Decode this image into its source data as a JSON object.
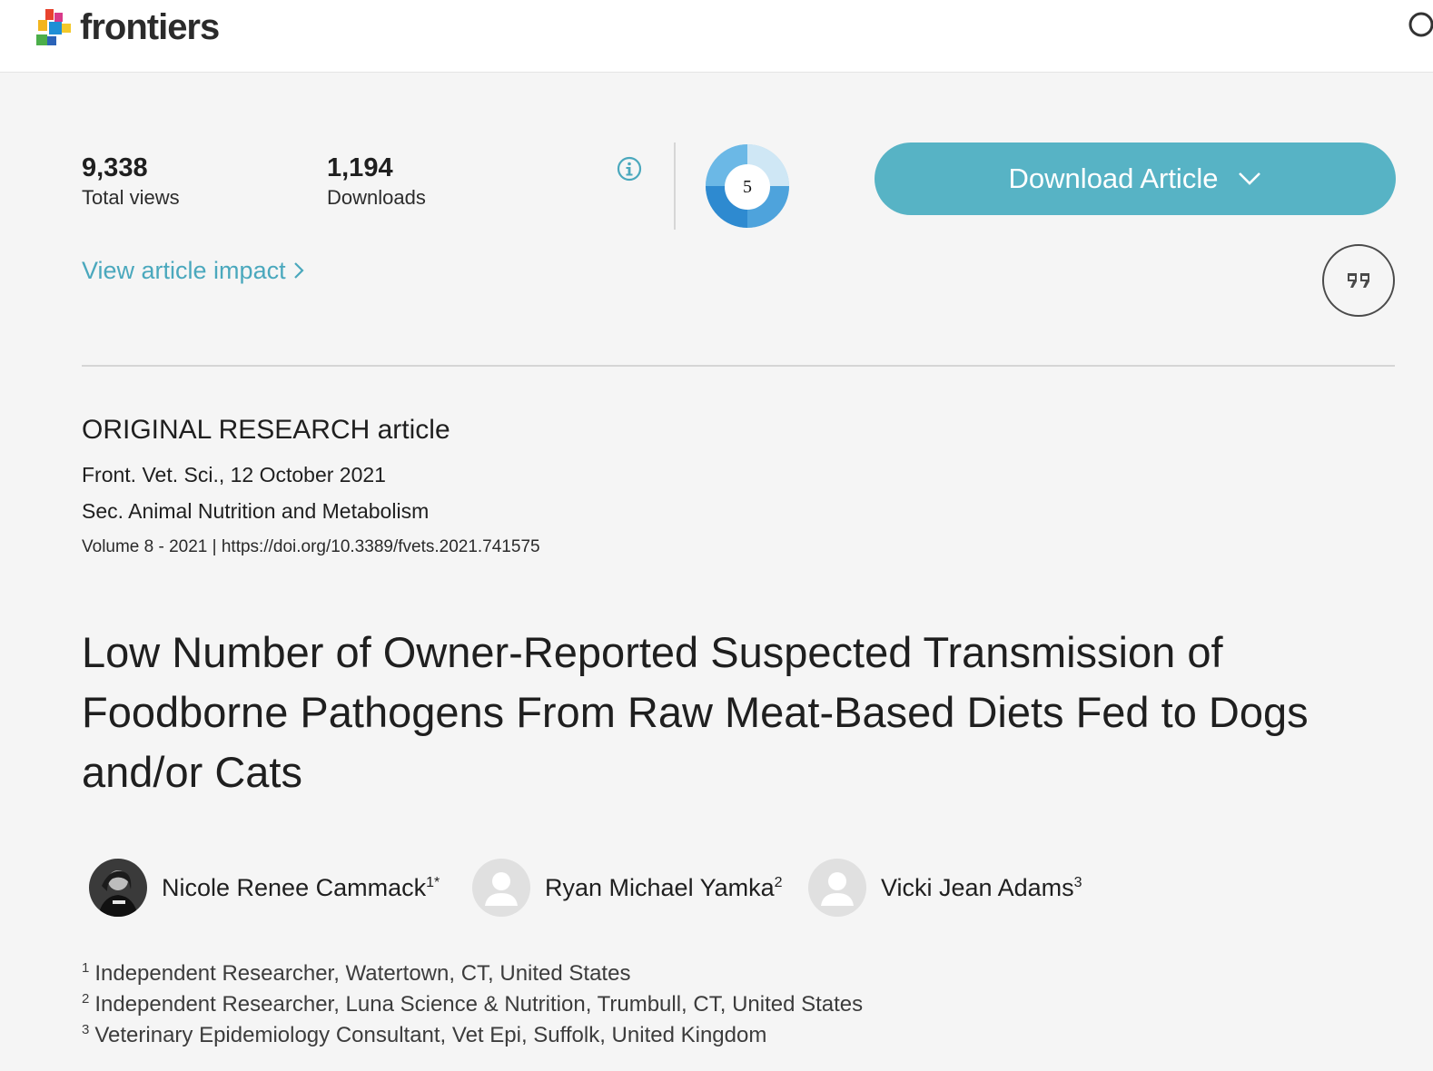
{
  "header": {
    "brand": "frontiers"
  },
  "metrics": {
    "total_views_value": "9,338",
    "total_views_label": "Total views",
    "downloads_value": "1,194",
    "downloads_label": "Downloads",
    "altmetric_score": "5",
    "view_impact_label": "View article impact"
  },
  "actions": {
    "download_label": "Download Article"
  },
  "article": {
    "type": "ORIGINAL RESEARCH article",
    "journal_date": "Front. Vet. Sci., 12 October 2021",
    "section": "Sec. Animal Nutrition and Metabolism",
    "volume_line": "Volume 8 - 2021 | https://doi.org/10.3389/fvets.2021.741575",
    "title": "Low Number of Owner-Reported Suspected Transmission of Foodborne Pathogens From Raw Meat-Based Diets Fed to Dogs and/or Cats"
  },
  "authors": [
    {
      "name": "Nicole Renee Cammack",
      "sup": "1*"
    },
    {
      "name": "Ryan Michael Yamka",
      "sup": "2"
    },
    {
      "name": "Vicki Jean Adams",
      "sup": "3"
    }
  ],
  "affiliations": [
    {
      "num": "1",
      "text": "Independent Researcher, Watertown, CT, United States"
    },
    {
      "num": "2",
      "text": "Independent Researcher, Luna Science & Nutrition, Trumbull, CT, United States"
    },
    {
      "num": "3",
      "text": "Veterinary Epidemiology Consultant, Vet Epi, Suffolk, United Kingdom"
    }
  ],
  "colors": {
    "accent": "#57b3c5",
    "link": "#4aa8bd",
    "background": "#f5f5f5"
  }
}
